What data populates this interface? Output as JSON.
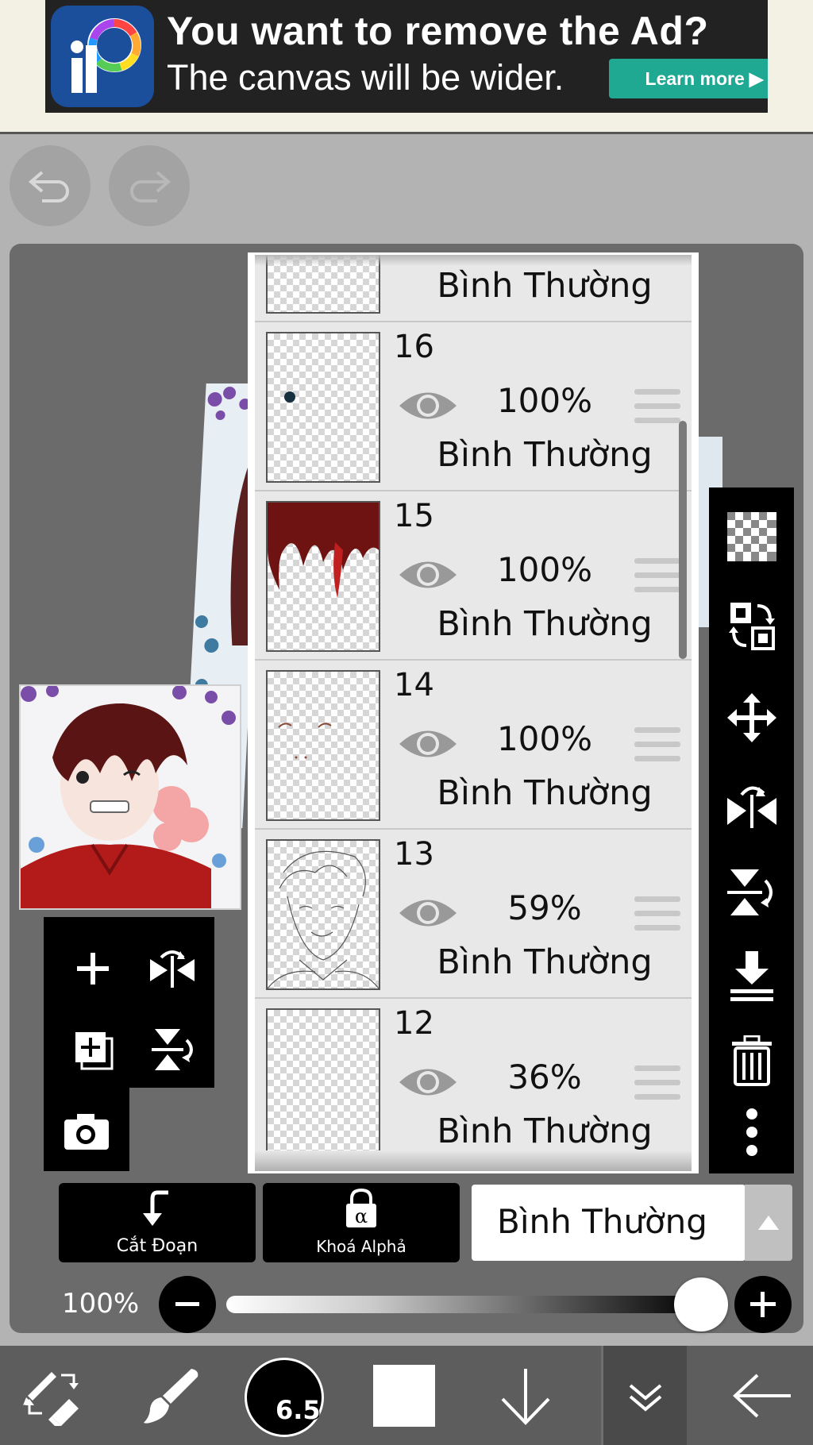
{
  "ad": {
    "title": "You want to remove the Ad?",
    "subtitle": "The canvas will be wider.",
    "button": "Learn more"
  },
  "layers": [
    {
      "number": "",
      "opacity": "",
      "blend": "Bình Thường"
    },
    {
      "number": "16",
      "opacity": "100%",
      "blend": "Bình Thường"
    },
    {
      "number": "15",
      "opacity": "100%",
      "blend": "Bình Thường"
    },
    {
      "number": "14",
      "opacity": "100%",
      "blend": "Bình Thường"
    },
    {
      "number": "13",
      "opacity": "59%",
      "blend": "Bình Thường"
    },
    {
      "number": "12",
      "opacity": "36%",
      "blend": "Bình Thường"
    }
  ],
  "controls": {
    "clipping_label": "Cắt Đoạn",
    "alpha_lock_label": "Khoá Alphả",
    "alpha_symbol": "α",
    "blend_mode": "Bình Thường",
    "opacity_label": "100%",
    "opacity_value": 1.0
  },
  "toolbar": {
    "brush_size": "6.5"
  },
  "colors": {
    "ad_button": "#1fa892",
    "panel_bg": "#e8e8e8",
    "foreground_color": "#ffffff"
  }
}
